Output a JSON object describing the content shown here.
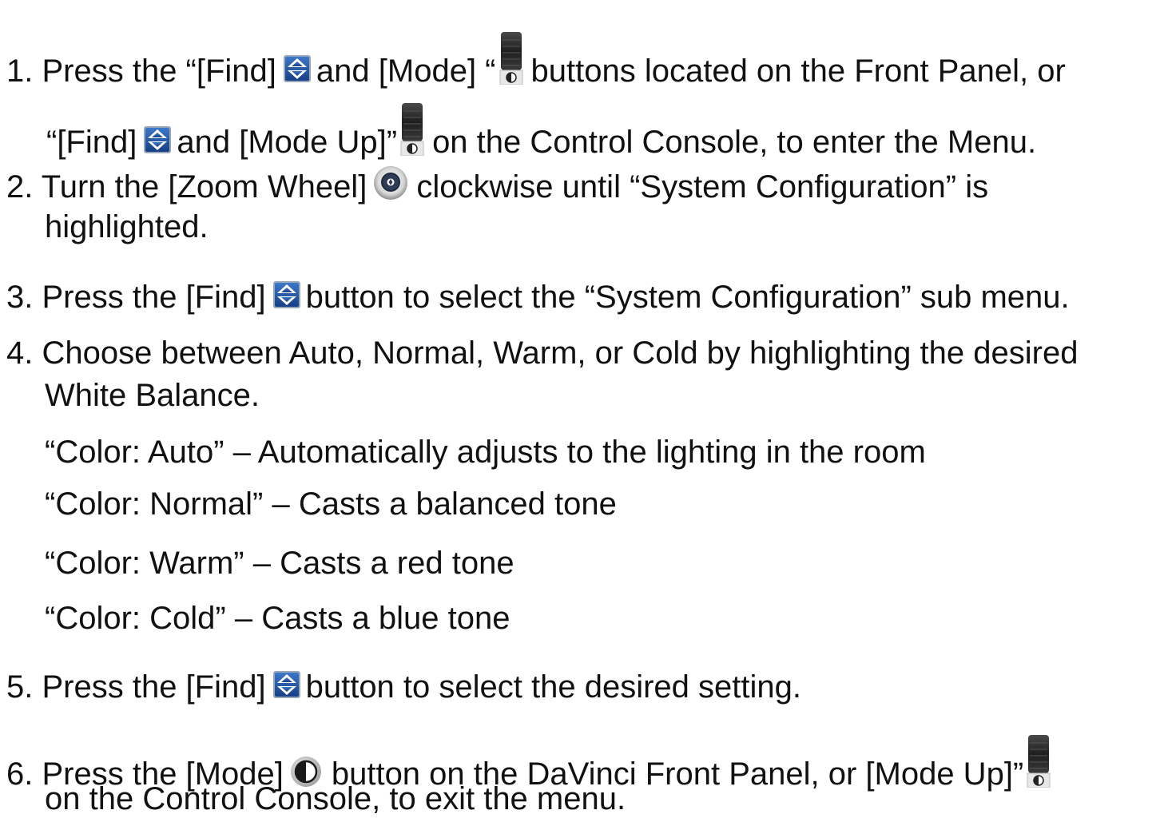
{
  "steps": {
    "s1": {
      "a": "1. Press the “[Find]",
      "b": "and [Mode] “",
      "c": "buttons located on the Front Panel, or",
      "d": "“[Find]",
      "e": "and [Mode Up]”",
      "f": "on the Control Console, to enter the Menu."
    },
    "s2": {
      "a": "2. Turn the [Zoom Wheel]",
      "b": "clockwise until “System Configuration” is",
      "c": "highlighted."
    },
    "s3": {
      "a": "3. Press the [Find]",
      "b": "button to select the “System Configuration” sub menu."
    },
    "s4": {
      "a": "4. Choose between Auto, Normal, Warm, or Cold by highlighting the desired",
      "b": "White Balance."
    },
    "colors": [
      "“Color: Auto” – Automatically adjusts to the lighting in the room",
      "“Color: Normal” – Casts a balanced tone",
      "“Color: Warm” – Casts a red tone",
      "“Color: Cold” – Casts a blue tone"
    ],
    "s5": {
      "a": "5. Press the [Find]",
      "b": "button to select the desired setting."
    },
    "s6": {
      "a": "6. Press the [Mode]",
      "b": "button on the DaVinci Front Panel, or [Mode Up]”",
      "c": "on the Control Console, to exit the menu."
    }
  },
  "icons": {
    "find": "find-button-icon",
    "mode_roller": "mode-up-roller-icon",
    "zoom_wheel": "zoom-wheel-icon",
    "mode": "mode-button-icon"
  },
  "colors_palette": {
    "find_blue": "#1e5aa8",
    "roller_dark": "#2a2a2a"
  }
}
